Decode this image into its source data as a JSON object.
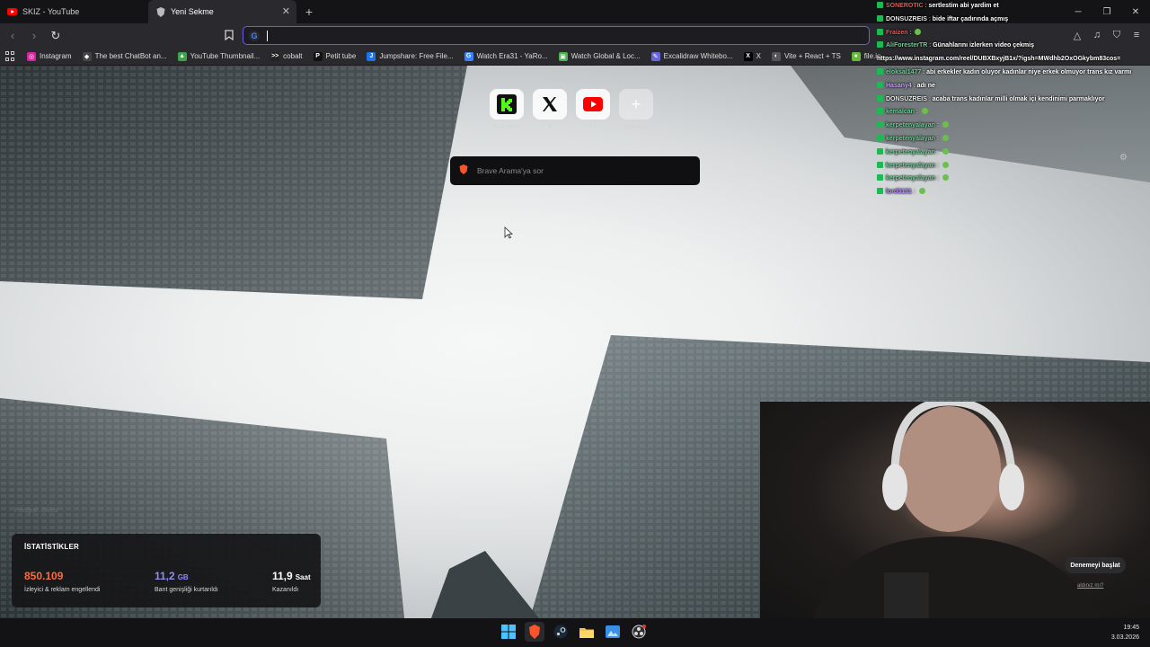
{
  "tabs": [
    {
      "title": "SKIZ - YouTube",
      "favicon": "youtube-icon",
      "active": false
    },
    {
      "title": "Yeni Sekme",
      "favicon": "brave-shield-icon",
      "active": true
    }
  ],
  "new_tab_symbol": "+",
  "window_controls": {
    "minimize": "─",
    "restore": "❐",
    "close": "✕"
  },
  "toolbar": {
    "back": "‹",
    "forward": "›",
    "reload": "↻",
    "omnibox_value": "",
    "search_engine_letter": "G"
  },
  "bookmarks": [
    {
      "label": "Instagram",
      "icon": "instagram-icon",
      "color": "#d6249f",
      "glyph": "◎"
    },
    {
      "label": "The best ChatBot an...",
      "icon": "chatbot-icon",
      "color": "#444",
      "glyph": "◆"
    },
    {
      "label": "YouTube Thumbnail...",
      "icon": "thumbnail-icon",
      "color": "#3fa34d",
      "glyph": "▲"
    },
    {
      "label": "cobalt",
      "icon": "cobalt-icon",
      "color": "#222",
      "glyph": ">>"
    },
    {
      "label": "Petit tube",
      "icon": "petit-tube-icon",
      "color": "#111",
      "glyph": "P"
    },
    {
      "label": "Jumpshare: Free File...",
      "icon": "jumpshare-icon",
      "color": "#1e73e8",
      "glyph": "J"
    },
    {
      "label": "Watch Era31 - YaRo...",
      "icon": "era31-icon",
      "color": "#3b82f6",
      "glyph": "G"
    },
    {
      "label": "Watch Global & Loc...",
      "icon": "watch-global-icon",
      "color": "#4caf50",
      "glyph": "▣"
    },
    {
      "label": "Excalidraw Whitebo...",
      "icon": "excalidraw-icon",
      "color": "#6965db",
      "glyph": "✎"
    },
    {
      "label": "X",
      "icon": "x-icon",
      "color": "#000",
      "glyph": "X"
    },
    {
      "label": "Vite + React + TS",
      "icon": "vite-icon",
      "color": "#555",
      "glyph": "◐"
    },
    {
      "label": "file.io",
      "icon": "fileio-icon",
      "color": "#66bb3a",
      "glyph": "●"
    }
  ],
  "top_sites": [
    {
      "label": "Kick | Kick",
      "icon": "kick-icon"
    },
    {
      "label": "X",
      "icon": "x-logo-icon"
    },
    {
      "label": "YT",
      "icon": "youtube-logo-icon"
    },
    {
      "label": "Site ekle",
      "icon": "add-site-icon"
    }
  ],
  "search": {
    "placeholder": "Brave Arama'ya sor"
  },
  "photo_credit": "Fotoğraf: Ghost",
  "stats": {
    "heading": "İSTATİSTİKLER",
    "items": [
      {
        "value": "850.109",
        "unit": "",
        "caption": "İzleyici & reklam engellendi",
        "color": "#ff6a3d"
      },
      {
        "value": "11,2",
        "unit": "GB",
        "caption": "Bant genişliği kurtarıldı",
        "color": "#8f8cf6"
      },
      {
        "value": "11,9",
        "unit": "Saat",
        "caption": "Kazanıldı",
        "color": "#ffffff"
      }
    ]
  },
  "chat": [
    {
      "user": "SONEROTIC",
      "msg": "sertlestim abi yardim et",
      "color": "#ff4d4d"
    },
    {
      "user": "DONSUZREIS",
      "msg": "bide iftar çadırında açmış",
      "color": "#e8e8e8"
    },
    {
      "user": "Fraizen",
      "msg": "",
      "color": "#ff4d4d",
      "emote": true
    },
    {
      "user": "AliForesterTR",
      "msg": "Günahlarını izlerken video çekmiş",
      "color": "#6fcf97"
    },
    {
      "user": "",
      "msg": "https://www.instagram.com/reel/DUBXBxyjB1x/?igsh=MWdhb2OxOGkybm83cos=",
      "color": "#ffffff"
    },
    {
      "user": "eloksal1477",
      "msg": "abi erkekler kadın oluyor kadınlar niye erkek olmuyor trans kız varmı",
      "color": "#6fcf97"
    },
    {
      "user": "Hasany4",
      "msg": "adı ne",
      "color": "#c9a3ff"
    },
    {
      "user": "DONSUZREIS",
      "msg": "acaba trans kadınlar milli olmak içi kendinimi parmaklıyor",
      "color": "#e8e8e8"
    },
    {
      "user": "kemalcan",
      "msg": "",
      "color": "#6fcf97",
      "emote": true
    },
    {
      "user": "kerpetenyalayan",
      "msg": "",
      "color": "#6fcf97",
      "emote": true
    },
    {
      "user": "kerpetenyalayan",
      "msg": "",
      "color": "#6fcf97",
      "emote": true
    },
    {
      "user": "kerpetenyalayan",
      "msg": "",
      "color": "#6fcf97",
      "emote": true
    },
    {
      "user": "kerpetenyalayan",
      "msg": "",
      "color": "#6fcf97",
      "emote": true
    },
    {
      "user": "kerpetenyalayan",
      "msg": "",
      "color": "#6fcf97",
      "emote": true
    },
    {
      "user": "lord3131",
      "msg": "",
      "color": "#b58cff",
      "emote": true
    }
  ],
  "promo": {
    "button": "Denemeyi başlat",
    "link": "aldınız mı?"
  },
  "taskbar": {
    "apps": [
      {
        "icon": "windows-start-icon"
      },
      {
        "icon": "brave-browser-icon"
      },
      {
        "icon": "steam-icon"
      },
      {
        "icon": "file-explorer-icon"
      },
      {
        "icon": "photos-icon"
      },
      {
        "icon": "obs-icon"
      }
    ],
    "time": "19:45",
    "date": "3.03.2026"
  }
}
